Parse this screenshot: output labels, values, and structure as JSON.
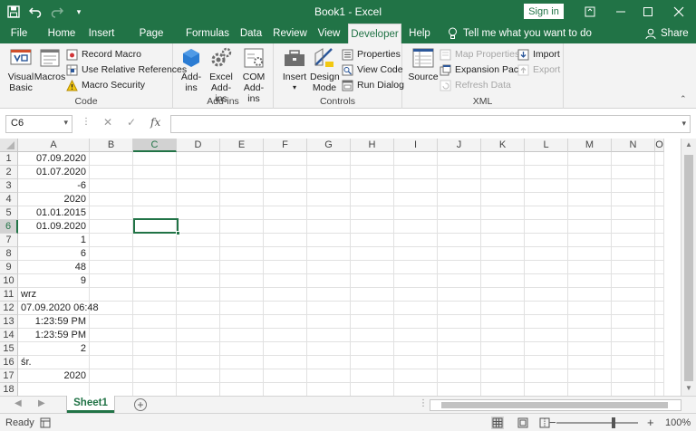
{
  "title": "Book1 - Excel",
  "signin": "Sign in",
  "tabs": [
    "File",
    "Home",
    "Insert",
    "Page Layout",
    "Formulas",
    "Data",
    "Review",
    "View",
    "Developer",
    "Help"
  ],
  "active_tab": "Developer",
  "tellme": "Tell me what you want to do",
  "share": "Share",
  "ribbon": {
    "code": {
      "label": "Code",
      "visual_basic": "Visual Basic",
      "macros": "Macros",
      "record_macro": "Record Macro",
      "use_relative": "Use Relative References",
      "macro_security": "Macro Security"
    },
    "addins": {
      "label": "Add-ins",
      "addins": "Add-ins",
      "excel_addins": "Excel Add-ins",
      "com_addins": "COM Add-ins"
    },
    "controls": {
      "label": "Controls",
      "insert": "Insert",
      "design_mode": "Design Mode",
      "properties": "Properties",
      "view_code": "View Code",
      "run_dialog": "Run Dialog"
    },
    "xml": {
      "label": "XML",
      "source": "Source",
      "map_properties": "Map Properties",
      "expansion_packs": "Expansion Packs",
      "refresh_data": "Refresh Data",
      "import": "Import",
      "export": "Export"
    }
  },
  "formula_bar": {
    "name_box": "C6",
    "formula": ""
  },
  "columns": [
    "A",
    "B",
    "C",
    "D",
    "E",
    "F",
    "G",
    "H",
    "I",
    "J",
    "K",
    "L",
    "M",
    "N",
    "O"
  ],
  "rows": [
    "1",
    "2",
    "3",
    "4",
    "5",
    "6",
    "7",
    "8",
    "9",
    "10",
    "11",
    "12",
    "13",
    "14",
    "15",
    "16",
    "17",
    "18"
  ],
  "cells_a": [
    "07.09.2020",
    "01.07.2020",
    "-6",
    "2020",
    "01.01.2015",
    "01.09.2020",
    "1",
    "6",
    "48",
    "9",
    "wrz",
    "07.09.2020 06:48",
    "1:23:59 PM",
    "1:23:59 PM",
    "2",
    "śr.",
    "2020",
    ""
  ],
  "cells_a_align": [
    "r",
    "r",
    "r",
    "r",
    "r",
    "r",
    "r",
    "r",
    "r",
    "r",
    "l",
    "r",
    "r",
    "r",
    "r",
    "l",
    "r",
    "r"
  ],
  "sheet": "Sheet1",
  "status": "Ready",
  "zoom": "100%",
  "colors": {
    "accent": "#217346"
  }
}
